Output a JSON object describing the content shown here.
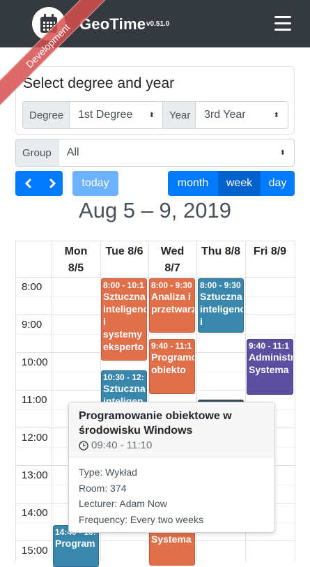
{
  "navbar": {
    "brand": "GeoTime",
    "version": "v0.51.0",
    "ribbon": "Development"
  },
  "selector": {
    "title": "Select degree and year",
    "degree_label": "Degree",
    "degree_value": "1st Degree",
    "year_label": "Year",
    "year_value": "3rd Year",
    "group_label": "Group",
    "group_value": "All"
  },
  "toolbar": {
    "prev_icon": "chevron-left-icon",
    "next_icon": "chevron-right-icon",
    "today": "today",
    "month": "month",
    "week": "week",
    "day": "day",
    "active_view": "week",
    "range_title": "Aug 5 – 9, 2019"
  },
  "calendar": {
    "days": [
      {
        "name": "Mon",
        "date": "8/5"
      },
      {
        "name": "Tue",
        "date": "8/6"
      },
      {
        "name": "Wed",
        "date": "8/7"
      },
      {
        "name": "Thu",
        "date": "8/8"
      },
      {
        "name": "Fri",
        "date": "8/9"
      }
    ],
    "times": [
      "8:00",
      "9:00",
      "10:00",
      "11:00",
      "12:00",
      "13:00",
      "14:00",
      "15:00"
    ],
    "events": [
      {
        "time": "8:00 - 10:1",
        "name": "Sztuczna inteligencja i systemy eksperto",
        "color": "#e0704a"
      },
      {
        "time": "8:00 - 9:30",
        "name": "Analiza i przetwarzanie",
        "color": "#e0704a"
      },
      {
        "time": "8:00 - 9:30",
        "name": "Sztuczna inteligencja i",
        "color": "#3a87ad"
      },
      {
        "time": "9:40 - 11:1",
        "name": "Programowanie obiekto",
        "color": "#e0704a"
      },
      {
        "time": "9:40 - 11:1",
        "name": "Administracja Systema",
        "color": "#5c4fa0"
      },
      {
        "time": "10:30 - 12:",
        "name": "Sztuczna inteligen",
        "color": "#3a87ad"
      },
      {
        "time": "14:40 - 16:",
        "name": "Program",
        "color": "#3a87ad"
      },
      {
        "time": "",
        "name": "Systema",
        "color": "#e0704a"
      }
    ]
  },
  "popover": {
    "title": "Programowanie obiektowe w środowisku Windows",
    "time": "09:40 - 11:10",
    "type": "Type: Wykład",
    "room": "Room: 374",
    "lecturer": "Lecturer: Adam Now",
    "frequency": "Frequency: Every two weeks"
  }
}
